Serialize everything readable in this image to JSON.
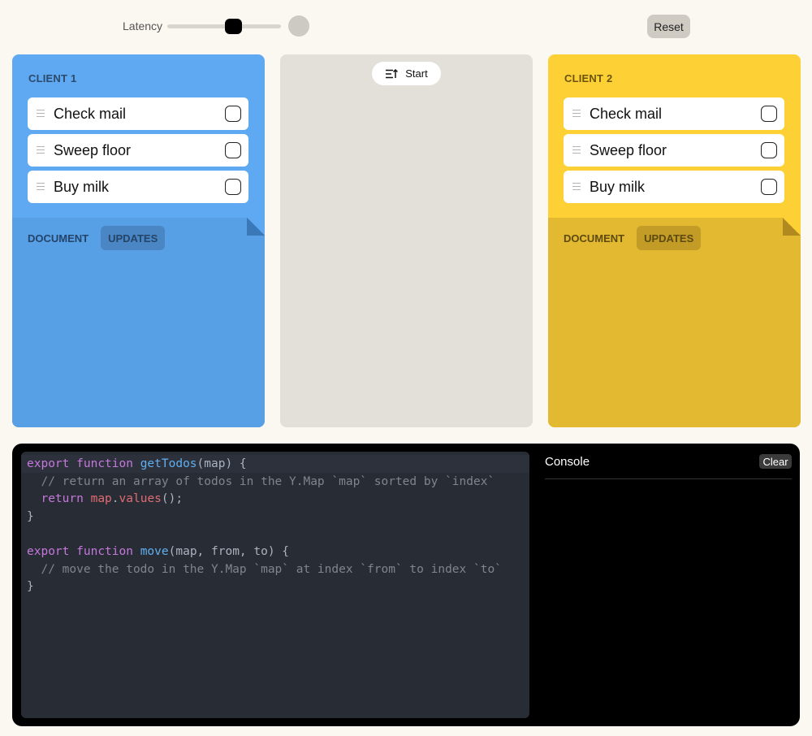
{
  "toolbar": {
    "latency_label": "Latency",
    "latency_value": 0.58,
    "reset_label": "Reset"
  },
  "clients": [
    {
      "title": "CLIENT 1",
      "color": "#5ea9f2",
      "todos": [
        {
          "text": "Check mail",
          "done": false
        },
        {
          "text": "Sweep floor",
          "done": false
        },
        {
          "text": "Buy milk",
          "done": false
        }
      ],
      "tabs": [
        {
          "label": "DOCUMENT",
          "active": false
        },
        {
          "label": "UPDATES",
          "active": true
        }
      ]
    },
    {
      "title": "CLIENT 2",
      "color": "#fdd135",
      "todos": [
        {
          "text": "Check mail",
          "done": false
        },
        {
          "text": "Sweep floor",
          "done": false
        },
        {
          "text": "Buy milk",
          "done": false
        }
      ],
      "tabs": [
        {
          "label": "DOCUMENT",
          "active": false
        },
        {
          "label": "UPDATES",
          "active": true
        }
      ]
    }
  ],
  "sync": {
    "start_label": "Start",
    "start_icon": "sort-arrow-icon"
  },
  "editor": {
    "language": "javascript",
    "lines": [
      "export function getTodos(map) {",
      "  // return an array of todos in the Y.Map `map` sorted by `index`",
      "  return map.values();",
      "}",
      "",
      "export function move(map, from, to) {",
      "  // move the todo in the Y.Map `map` at index `from` to index `to`",
      "}"
    ]
  },
  "console": {
    "title": "Console",
    "clear_label": "Clear"
  }
}
